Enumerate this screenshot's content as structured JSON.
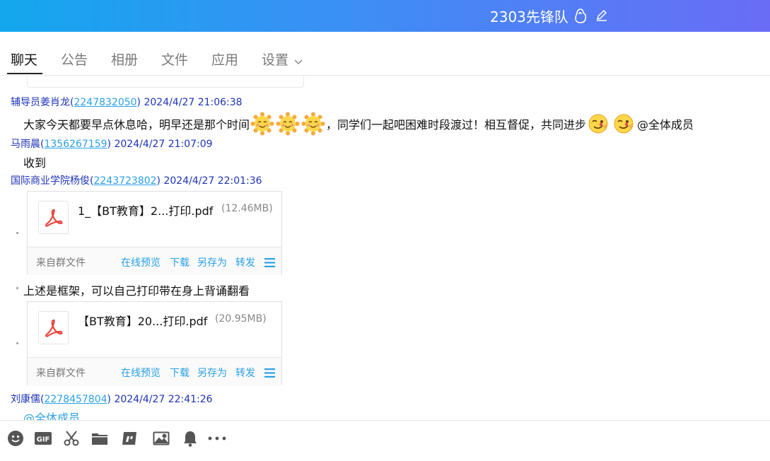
{
  "window": {
    "title": "2303先锋队"
  },
  "tabs": [
    {
      "label": "聊天",
      "active": true
    },
    {
      "label": "公告",
      "active": false
    },
    {
      "label": "相册",
      "active": false
    },
    {
      "label": "文件",
      "active": false
    },
    {
      "label": "应用",
      "active": false
    },
    {
      "label": "设置",
      "active": false
    }
  ],
  "messages": [
    {
      "sender_name": "辅导员姜肖龙",
      "sender_qq": "2247832050",
      "time": "2024/4/27 21:06:38",
      "text_before": "大家今天都要早点休息哈，明早还是那个时间",
      "text_middle": "，同学们一起吧困难时段渡过！相互督促，共同进步",
      "mention": "@全体成员"
    },
    {
      "sender_name": "马雨晨",
      "sender_qq": "1356267159",
      "time": "2024/4/27 21:07:09",
      "text": "收到"
    },
    {
      "sender_name": "国际商业学院杨俊",
      "sender_qq": "2243723802",
      "time": "2024/4/27 22:01:36",
      "files": [
        {
          "name": "1_【BT教育】2...打印.pdf",
          "size": "(12.46MB)"
        },
        {
          "name": "【BT教育】20...打印.pdf",
          "size": "(20.95MB)"
        }
      ],
      "text": "上述是框架，可以自己打印带在身上背诵翻看"
    },
    {
      "sender_name": "刘康儒",
      "sender_qq": "2278457804",
      "time": "2024/4/27 22:41:26",
      "text": "@全体成员"
    }
  ],
  "file_card": {
    "source": "来自群文件",
    "actions": [
      "在线预览",
      "下载",
      "另存为",
      "转发"
    ]
  },
  "icons": {
    "title": "fist-icon",
    "edit": "pencil-icon",
    "toolbar": [
      "emoji-icon",
      "gif-icon",
      "scissors-icon",
      "folder-icon",
      "sticker-icon",
      "image-icon",
      "bell-icon",
      "more-icon"
    ]
  },
  "colors": {
    "sender_name": "#1d33b7",
    "qq_link": "#2aa0e6",
    "action_link": "#2aa0e6",
    "title_gradient_start": "#13a7ee",
    "title_gradient_end": "#6a6cf6"
  }
}
